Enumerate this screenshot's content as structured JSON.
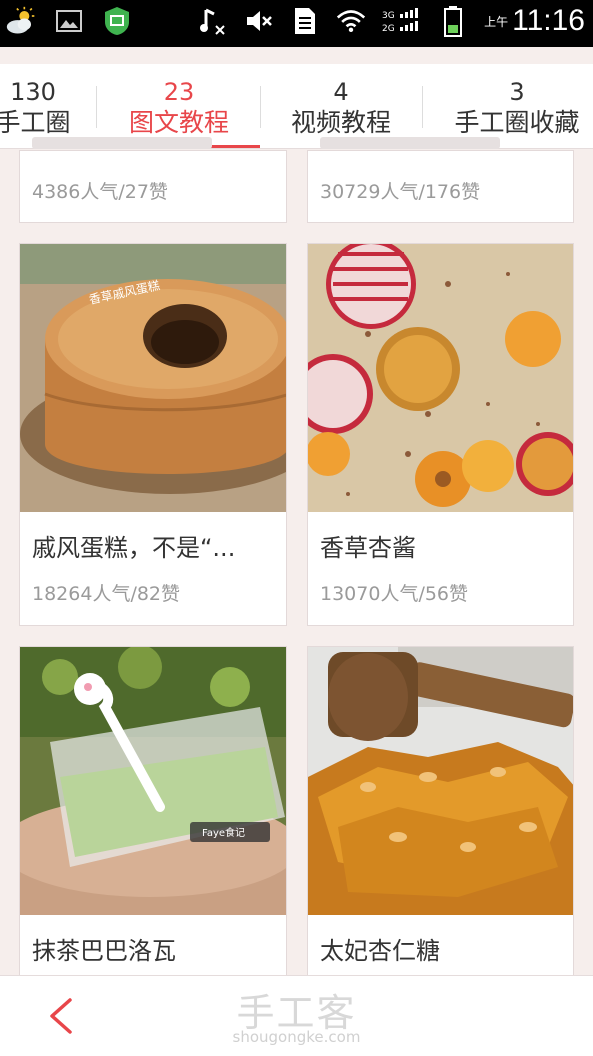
{
  "status_bar": {
    "net_label": "3G 2G",
    "ampm": "上午",
    "time": "11:16"
  },
  "tabs": [
    {
      "count": "130",
      "label": "手工圈"
    },
    {
      "count": "23",
      "label": "图文教程"
    },
    {
      "count": "4",
      "label": "视频教程"
    },
    {
      "count": "3",
      "label": "手工圈收藏"
    }
  ],
  "active_tab": 1,
  "cards": [
    {
      "title": "",
      "stats": "4386人气/27赞"
    },
    {
      "title": "",
      "stats": "30729人气/176赞"
    },
    {
      "title": "戚风蛋糕，不是“...",
      "stats": "18264人气/82赞"
    },
    {
      "title": "香草杏酱",
      "stats": "13070人气/56赞"
    },
    {
      "title": "抹茶巴巴洛瓦",
      "stats": ""
    },
    {
      "title": "太妃杏仁糖",
      "stats": ""
    }
  ],
  "image_overlays": {
    "cake_caption": "香草戚风蛋糕",
    "watermark": "Faye食记"
  },
  "bottom_bar": {
    "logo": "手工客",
    "url": "shougongke.com"
  },
  "colors": {
    "accent": "#e8464a",
    "background": "#f6eeec"
  }
}
